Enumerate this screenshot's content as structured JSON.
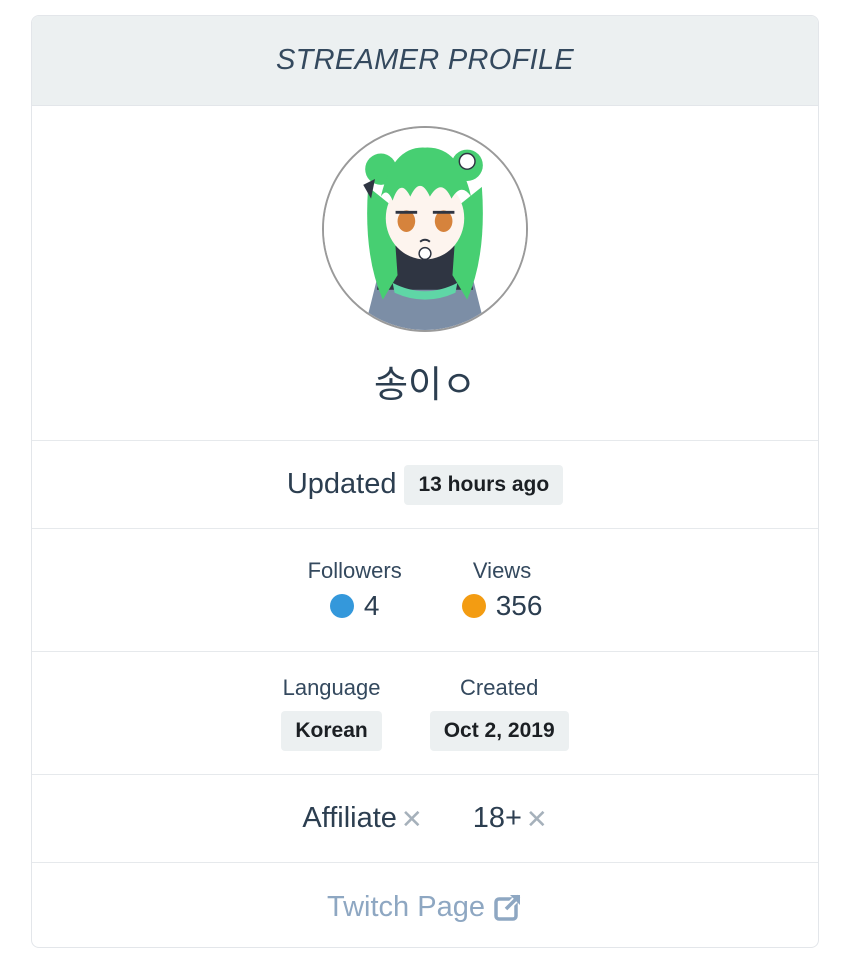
{
  "header": {
    "title": "STREAMER PROFILE"
  },
  "profile": {
    "name": "송이ㅇ",
    "avatar_icon": "avatar-image"
  },
  "updated": {
    "label": "Updated",
    "value": "13 hours ago"
  },
  "stats": {
    "followers": {
      "label": "Followers",
      "value": "4",
      "color": "#3498db"
    },
    "views": {
      "label": "Views",
      "value": "356",
      "color": "#f39c12"
    }
  },
  "meta": {
    "language": {
      "label": "Language",
      "value": "Korean"
    },
    "created": {
      "label": "Created",
      "value": "Oct 2, 2019"
    }
  },
  "flags": {
    "affiliate": {
      "label": "Affiliate",
      "icon": "x-icon"
    },
    "mature": {
      "label": "18+",
      "icon": "x-icon"
    }
  },
  "link": {
    "label": "Twitch Page",
    "icon": "external-link-icon",
    "color": "#8ea7c2"
  }
}
